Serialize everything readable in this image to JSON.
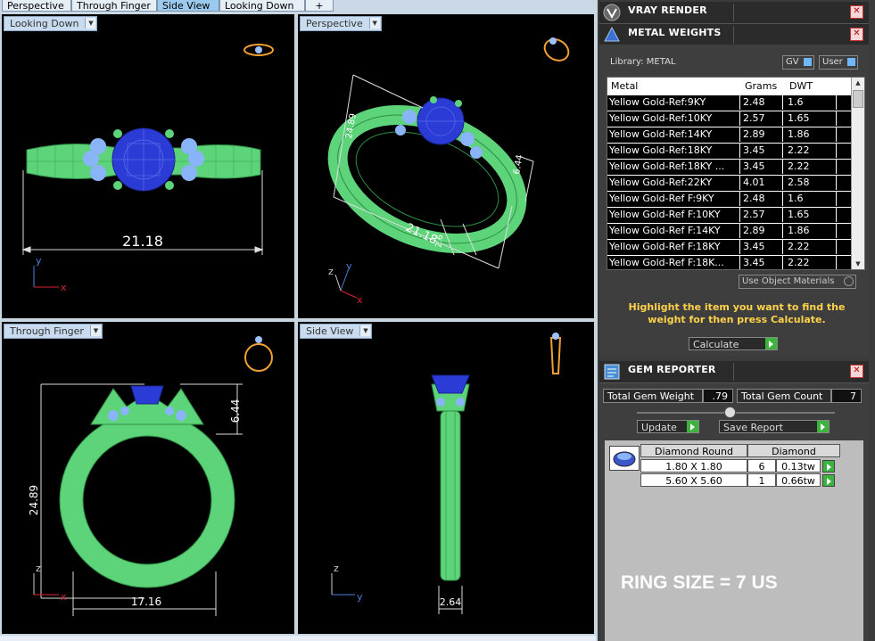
{
  "tabs": [
    "Perspective",
    "Through Finger",
    "Side View",
    "Looking Down"
  ],
  "tab_add": "+",
  "active_tab": 2,
  "viewports": {
    "top_left": {
      "label": "Looking Down",
      "dim": "21.18"
    },
    "top_right": {
      "label": "Perspective",
      "dim_length": "21.18",
      "dim_height": "24.89",
      "dim_gem": "6.44",
      "dim_width": "2.6"
    },
    "bottom_left": {
      "label": "Through Finger",
      "dim_height": "24.89",
      "dim_gem": "6.44",
      "dim_width": "17.16"
    },
    "bottom_right": {
      "label": "Side View",
      "dim_width": "2.64"
    }
  },
  "axes": {
    "x": "x",
    "y": "y",
    "z": "z"
  },
  "panels": {
    "vray": {
      "title": "VRAY RENDER"
    },
    "metal": {
      "title": "METAL WEIGHTS",
      "library": "Library: METAL",
      "gv": "GV",
      "user": "User",
      "columns": [
        "Metal",
        "Grams",
        "DWT"
      ],
      "rows": [
        [
          "Yellow Gold-Ref:9KY",
          "2.48",
          "1.6"
        ],
        [
          "Yellow Gold-Ref:10KY",
          "2.57",
          "1.65"
        ],
        [
          "Yellow Gold-Ref:14KY",
          "2.89",
          "1.86"
        ],
        [
          "Yellow Gold-Ref:18KY",
          "3.45",
          "2.22"
        ],
        [
          "Yellow Gold-Ref:18KY ...",
          "3.45",
          "2.22"
        ],
        [
          "Yellow Gold-Ref:22KY",
          "4.01",
          "2.58"
        ],
        [
          "Yellow Gold-Ref F:9KY",
          "2.48",
          "1.6"
        ],
        [
          "Yellow Gold-Ref F:10KY",
          "2.57",
          "1.65"
        ],
        [
          "Yellow Gold-Ref F:14KY",
          "2.89",
          "1.86"
        ],
        [
          "Yellow Gold-Ref F:18KY",
          "3.45",
          "2.22"
        ],
        [
          "Yellow Gold-Ref F:18K...",
          "3.45",
          "2.22"
        ]
      ],
      "use_object_materials": "Use Object Materials",
      "hint": "Highlight the item you want to find the weight for then press Calculate.",
      "calculate": "Calculate"
    },
    "gem": {
      "title": "GEM REPORTER",
      "total_weight_label": "Total Gem Weight",
      "total_weight": ".79",
      "total_count_label": "Total Gem Count",
      "total_count": "7",
      "update": "Update",
      "save_report": "Save Report",
      "header": [
        "Diamond Round",
        "Diamond"
      ],
      "rows": [
        [
          "1.80 X 1.80",
          "6",
          "0.13tw"
        ],
        [
          "5.60 X 5.60",
          "1",
          "0.66tw"
        ]
      ],
      "ring_size": "RING SIZE = 7 US"
    }
  },
  "colors": {
    "ring": "#5dd47a",
    "gem": "#2b3bd6",
    "accent": "#9cc9ee",
    "button": "#3cb33c",
    "hint": "#ffd24a"
  }
}
